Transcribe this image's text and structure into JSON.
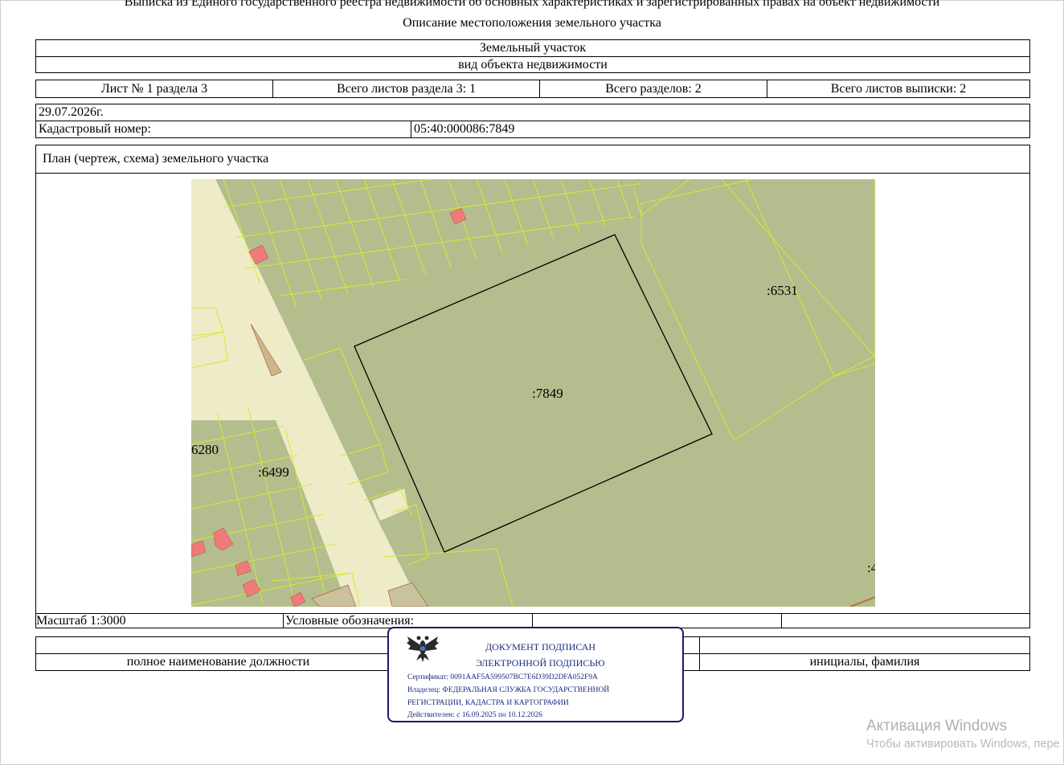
{
  "header": {
    "title": "Выписка из Единого государственного реестра недвижимости об основных характеристиках и зарегистрированных правах на объект недвижимости",
    "subtitle": "Описание местоположения земельного участка"
  },
  "object": {
    "name": "Земельный участок",
    "caption": "вид объекта недвижимости"
  },
  "sheets": {
    "sheet": "Лист № 1 раздела 3",
    "total_section": "Всего листов раздела 3: 1",
    "total_sections": "Всего разделов: 2",
    "total_extract": "Всего листов выписки: 2"
  },
  "date": "29.07.2026г.",
  "cadastral": {
    "label": "Кадастровый номер:",
    "value": "05:40:000086:7849"
  },
  "plan": {
    "header": "План (чертеж, схема) земельного участка",
    "labels": {
      "main": ":7849",
      "p6531": ":6531",
      "p6280": "6280",
      "p6499": ":6499",
      "p4": ":4"
    },
    "colors": {
      "parcel_fill": "#b3bd8e",
      "road_fill": "#eeebc8",
      "boundary": "#d8ea2a",
      "building": "#f07a7a",
      "target_outline": "#000000"
    }
  },
  "footer": {
    "scale": "Масштаб 1:3000",
    "legend": "Условные обозначения:",
    "position": "полное наименование должности",
    "initials": "инициалы, фамилия"
  },
  "stamp": {
    "line1": "ДОКУМЕНТ ПОДПИСАН",
    "line2": "ЭЛЕКТРОННОЙ ПОДПИСЬЮ",
    "cert": "Сертификат: 0091AAF5A599507BC7E6D39D2DFA052F9A",
    "owner1": "Владелец: ФЕДЕРАЛЬНАЯ СЛУЖБА ГОСУДАРСТВЕННОЙ",
    "owner2": "РЕГИСТРАЦИИ, КАДАСТРА И КАРТОГРАФИИ",
    "valid": "Действителен: с 16.09.2025 по 10.12.2026"
  },
  "watermark": {
    "line1": "Активация Windows",
    "line2": "Чтобы активировать Windows, пере"
  }
}
